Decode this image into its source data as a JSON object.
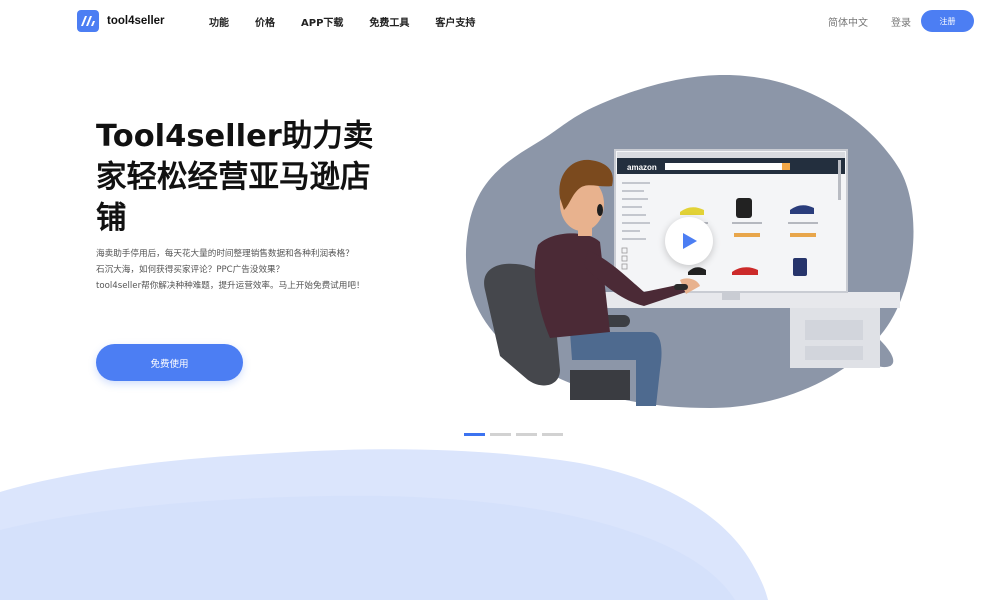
{
  "header": {
    "logo_text": "tool4seller",
    "nav": [
      "功能",
      "价格",
      "APP下载",
      "免费工具",
      "客户支持"
    ],
    "lang": "简体中文",
    "login": "登录",
    "register": "注册"
  },
  "hero": {
    "title": "Tool4seller助力卖家轻松经营亚马逊店铺",
    "desc": [
      "海卖助手停用后，每天花大量的时间整理销售数据和各种利润表格？",
      "石沉大海，如何获得买家评论？PPC广告没效果？",
      "tool4seller帮你解决种种难题，提升运营效率。马上开始免费试用吧！"
    ],
    "cta": "免费使用"
  },
  "illustration": {
    "store_logo": "amazon"
  },
  "carousel": {
    "slide_count": 4,
    "active_index": 0
  },
  "colors": {
    "accent": "#4c7ef3",
    "blob": "#8c96a8",
    "wave": "#dbe5fc"
  }
}
